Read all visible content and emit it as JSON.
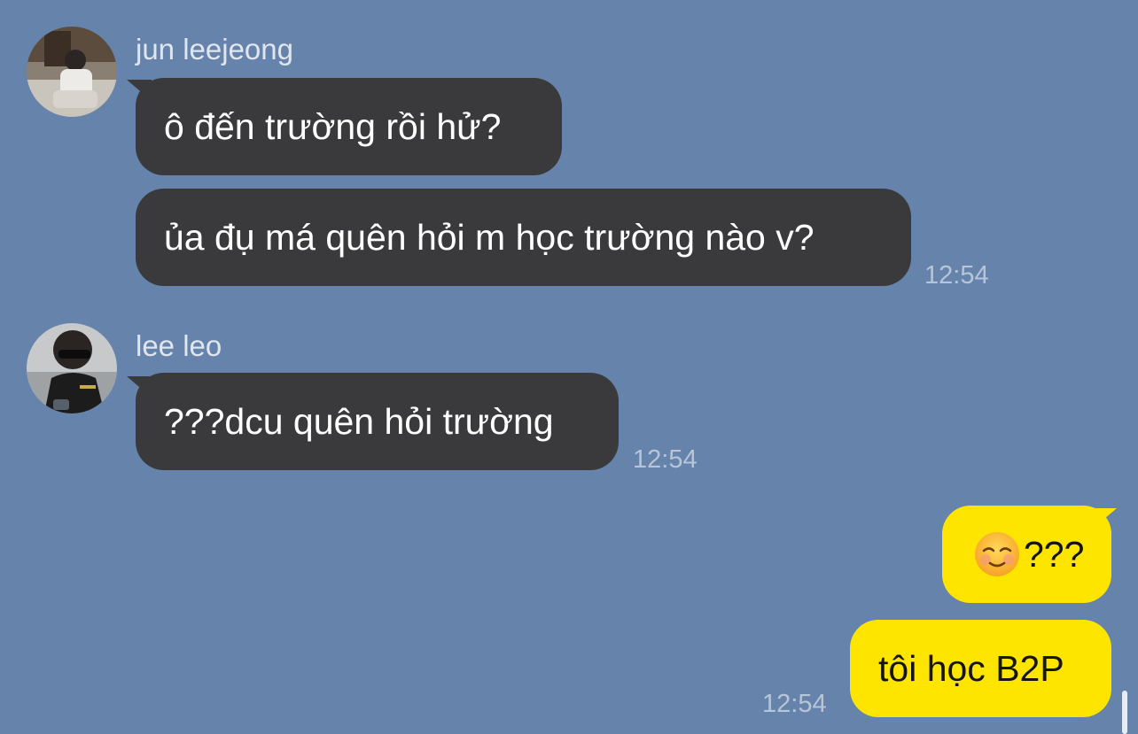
{
  "messages": {
    "group1": {
      "sender": "jun leejeong",
      "avatar_icon": "profile-photo-person-sitting",
      "bubbles": [
        "ô đến trường rồi hử?",
        "ủa đụ má quên hỏi m học trường nào v?"
      ],
      "time": "12:54"
    },
    "group2": {
      "sender": "lee leo",
      "avatar_icon": "profile-photo-person-sunglasses",
      "bubbles": [
        "???dcu quên hỏi trường"
      ],
      "time": "12:54"
    },
    "group3": {
      "emoji_icon": "smiling-face-emoji",
      "bubbles": [
        "???",
        "tôi học B2P"
      ],
      "time": "12:54"
    }
  },
  "colors": {
    "background": "#6583ab",
    "incoming_bubble": "#3a3a3c",
    "outgoing_bubble": "#fee500"
  }
}
